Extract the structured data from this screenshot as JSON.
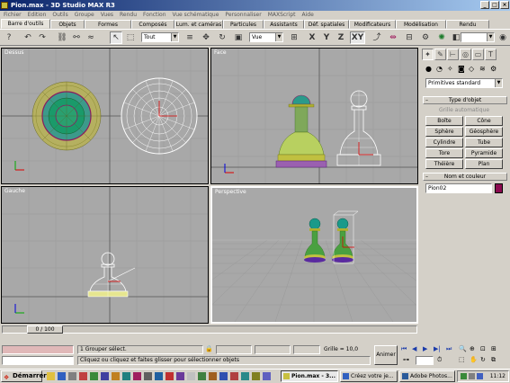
{
  "window": {
    "title": "Pion.max - 3D Studio MAX R3",
    "min": "_",
    "max": "□",
    "close": "×"
  },
  "menu": [
    "Fichier",
    "Edition",
    "Outils",
    "Groupe",
    "Vues",
    "Rendu",
    "Fonction",
    "Vue schématique",
    "Personnaliser",
    "MAXScript",
    "Aide"
  ],
  "tabs": [
    "Barre d'outils",
    "Objets",
    "Formes",
    "Composés",
    "Lum. et caméras",
    "Particules",
    "Assistants",
    "Déf. spatiales",
    "Modificateurs",
    "Modélisation",
    "Rendu"
  ],
  "toolbar": {
    "select_filter": "Tout",
    "ref_coord": "Vue",
    "axes": [
      "X",
      "Y",
      "Z",
      "XY"
    ],
    "named_selection": ""
  },
  "viewports": {
    "top": "Dessus",
    "front": "Face",
    "left": "Gauche",
    "perspective": "Perspective"
  },
  "panel": {
    "category": "Primitives standard",
    "object_type_header": "Type d'objet",
    "autogrid": "Grille automatique",
    "buttons": [
      "Boîte",
      "Cône",
      "Sphère",
      "Géosphère",
      "Cylindre",
      "Tube",
      "Tore",
      "Pyramide",
      "Théière",
      "Plan"
    ],
    "name_color_header": "Nom et couleur",
    "object_name": "Pion02",
    "object_color": "#8b0a50"
  },
  "timeslider": {
    "frame": "0 / 100"
  },
  "status": {
    "selection": "1 Grouper sélect.",
    "prompt": "Cliquez ou cliquez et faites glisser pour sélectionner objets",
    "grid": "Grille = 10,0",
    "animate": "Animer"
  },
  "taskbar": {
    "start": "Démarrer",
    "tasks": [
      "Pion.max - 3...",
      "Créez votre je...",
      "Adobe Photos..."
    ],
    "clock": "11:12"
  }
}
